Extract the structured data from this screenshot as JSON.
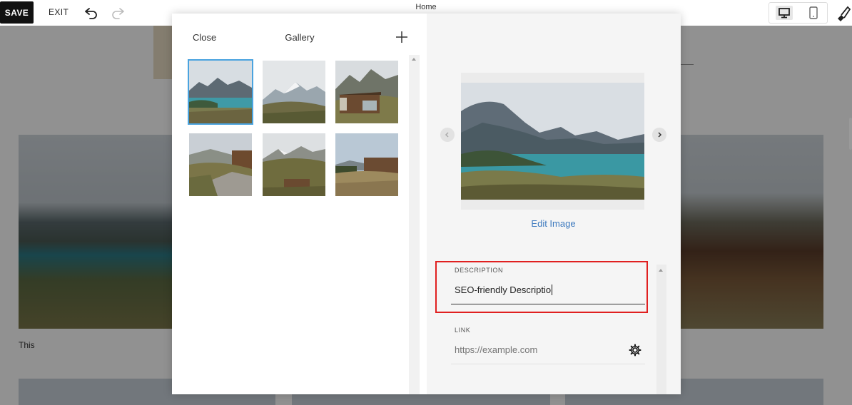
{
  "topbar": {
    "save_label": "SAVE",
    "exit_label": "EXIT",
    "page_name": "Home",
    "icons": [
      "undo-icon",
      "redo-icon",
      "desktop-icon",
      "mobile-icon",
      "brush-icon"
    ]
  },
  "background": {
    "caption": "This"
  },
  "gallery": {
    "close_label": "Close",
    "title": "Gallery",
    "add_icon": "plus-icon",
    "thumbnails": [
      {
        "name": "lake-mountains",
        "selected": true
      },
      {
        "name": "snowy-peaks",
        "selected": false
      },
      {
        "name": "cabin-mountain",
        "selected": false
      },
      {
        "name": "cabin-hillside",
        "selected": false
      },
      {
        "name": "cabin-grass",
        "selected": false
      },
      {
        "name": "cabin-field",
        "selected": false
      }
    ]
  },
  "editor": {
    "edit_image_label": "Edit Image",
    "description": {
      "label": "DESCRIPTION",
      "value": "SEO-friendly Descriptio"
    },
    "link": {
      "label": "LINK",
      "placeholder": "https://example.com"
    },
    "highlight_color": "#e02020",
    "accent_color": "#3f7bbf"
  }
}
